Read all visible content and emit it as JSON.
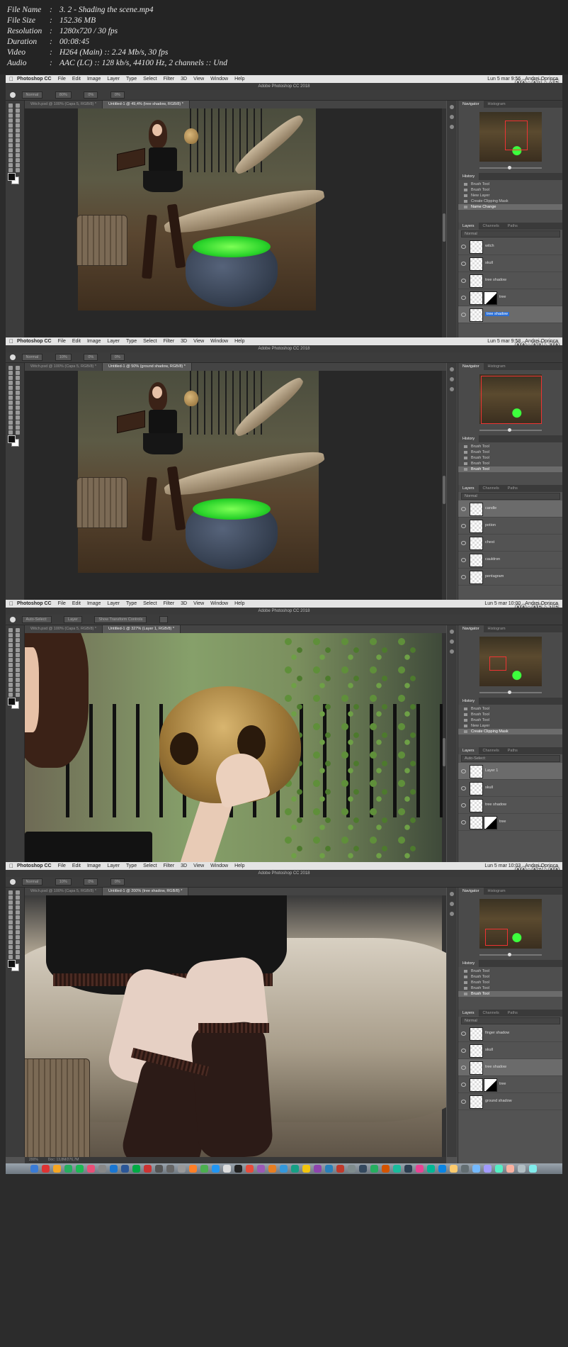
{
  "file_info": [
    {
      "key": "File Name",
      "value": "3. 2 - Shading the scene.mp4"
    },
    {
      "key": "File Size",
      "value": "152.36 MB"
    },
    {
      "key": "Resolution",
      "value": "1280x720 / 30 fps"
    },
    {
      "key": "Duration",
      "value": "00:08:45"
    },
    {
      "key": "Video",
      "value": "H264 (Main) :: 2.24 Mb/s, 30 fps"
    },
    {
      "key": "Audio",
      "value": "AAC (LC) :: 128 kb/s, 44100 Hz, 2 channels :: Und"
    }
  ],
  "app": {
    "name": "Photoshop CC",
    "menus": [
      "Photoshop CC",
      "File",
      "Edit",
      "Image",
      "Layer",
      "Type",
      "Select",
      "Filter",
      "3D",
      "View",
      "Window",
      "Help"
    ],
    "window_title": "Adobe Photoshop CC 2018",
    "panel_tabs_top": [
      "Navigator",
      "Histogram"
    ],
    "panel_tabs_layers": [
      "Layers",
      "Channels",
      "Paths"
    ],
    "history_title": "History",
    "user": "Andrei Oprinca"
  },
  "frames": [
    {
      "timestamp": "00:01:45",
      "clock": "Lun 5 mar 9:56",
      "tabs": [
        "Witch.psd @ 100% (Capa 5, RGB/8) *",
        "Untitled-1 @ 49,4% (tree shadow, RGB/8) *"
      ],
      "options": {
        "mode": "Normal",
        "opacity": "80%",
        "flow": "0%",
        "smoothing": "0%"
      },
      "zoom": "49,43%",
      "doc": "Doc: 13,8M/264,3M",
      "history": [
        "Brush Tool",
        "Brush Tool",
        "New Layer",
        "Create Clipping Mask",
        "Name Change"
      ],
      "layers": [
        "witch",
        "skull",
        "tree shadow",
        "tree",
        "tree shadow"
      ]
    },
    {
      "timestamp": "00:03:30",
      "clock": "Lun 5 mar 9:58",
      "tabs": [
        "Witch.psd @ 100% (Capa 5, RGB/8) *",
        "Untitled-1 @ 50% (ground shadow, RGB/8) *"
      ],
      "options": {
        "mode": "Normal",
        "opacity": "10%",
        "flow": "0%",
        "smoothing": "0%"
      },
      "zoom": "50%",
      "doc": "Doc: 13,8M/258,2M",
      "history": [
        "Brush Tool",
        "Brush Tool",
        "Brush Tool",
        "Brush Tool",
        "Brush Tool"
      ],
      "layers": [
        "candle",
        "potion",
        "chest",
        "cauldron",
        "pentagram"
      ]
    },
    {
      "timestamp": "00:05:15",
      "clock": "Lun 5 mar 10:00",
      "tabs": [
        "Witch.psd @ 100% (Capa 5, RGB/8) *",
        "Untitled-1 @ 327% (Layer 1, RGB/8) *"
      ],
      "options": {
        "mode": "Auto-Select:",
        "opacity": "Layer",
        "flow": "Show Transform Controls",
        "smoothing": ""
      },
      "zoom": "326,74%",
      "doc": "Doc: 13,8M/263,3M",
      "history": [
        "Brush Tool",
        "Brush Tool",
        "Brush Tool",
        "New Layer",
        "Create Clipping Mask"
      ],
      "layers": [
        "Layer 1",
        "skull",
        "tree shadow",
        "tree"
      ]
    },
    {
      "timestamp": "00:07:00",
      "clock": "Lun 5 mar 10:03",
      "tabs": [
        "Witch.psd @ 100% (Capa 5, RGB/8) *",
        "Untitled-1 @ 200% (tree shadow, RGB/8) *"
      ],
      "options": {
        "mode": "Normal",
        "opacity": "10%",
        "flow": "0%",
        "smoothing": "0%"
      },
      "zoom": "200%",
      "doc": "Doc: 13,8M/276,7M",
      "history": [
        "Brush Tool",
        "Brush Tool",
        "Brush Tool",
        "Brush Tool",
        "Brush Tool"
      ],
      "layers": [
        "finger shadow",
        "skull",
        "tree shadow",
        "tree",
        "ground shadow"
      ]
    }
  ]
}
